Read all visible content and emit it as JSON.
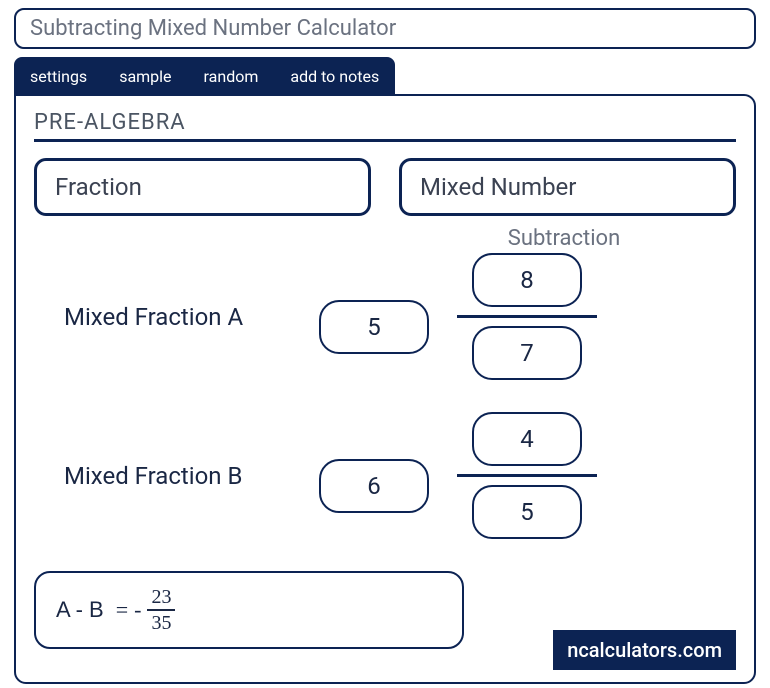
{
  "title": "Subtracting Mixed Number Calculator",
  "tabs": {
    "settings": "settings",
    "sample": "sample",
    "random": "random",
    "notes": "add to notes"
  },
  "section": "PRE-ALGEBRA",
  "types": {
    "fraction": "Fraction",
    "mixed": "Mixed Number"
  },
  "operation": "Subtraction",
  "rowA": {
    "label": "Mixed Fraction A",
    "whole": "5",
    "num": "8",
    "den": "7"
  },
  "rowB": {
    "label": "Mixed Fraction B",
    "whole": "6",
    "num": "4",
    "den": "5"
  },
  "result": {
    "lhs": "A - B",
    "eq": "=",
    "sign": "-",
    "num": "23",
    "den": "35"
  },
  "brand": "ncalculators.com"
}
